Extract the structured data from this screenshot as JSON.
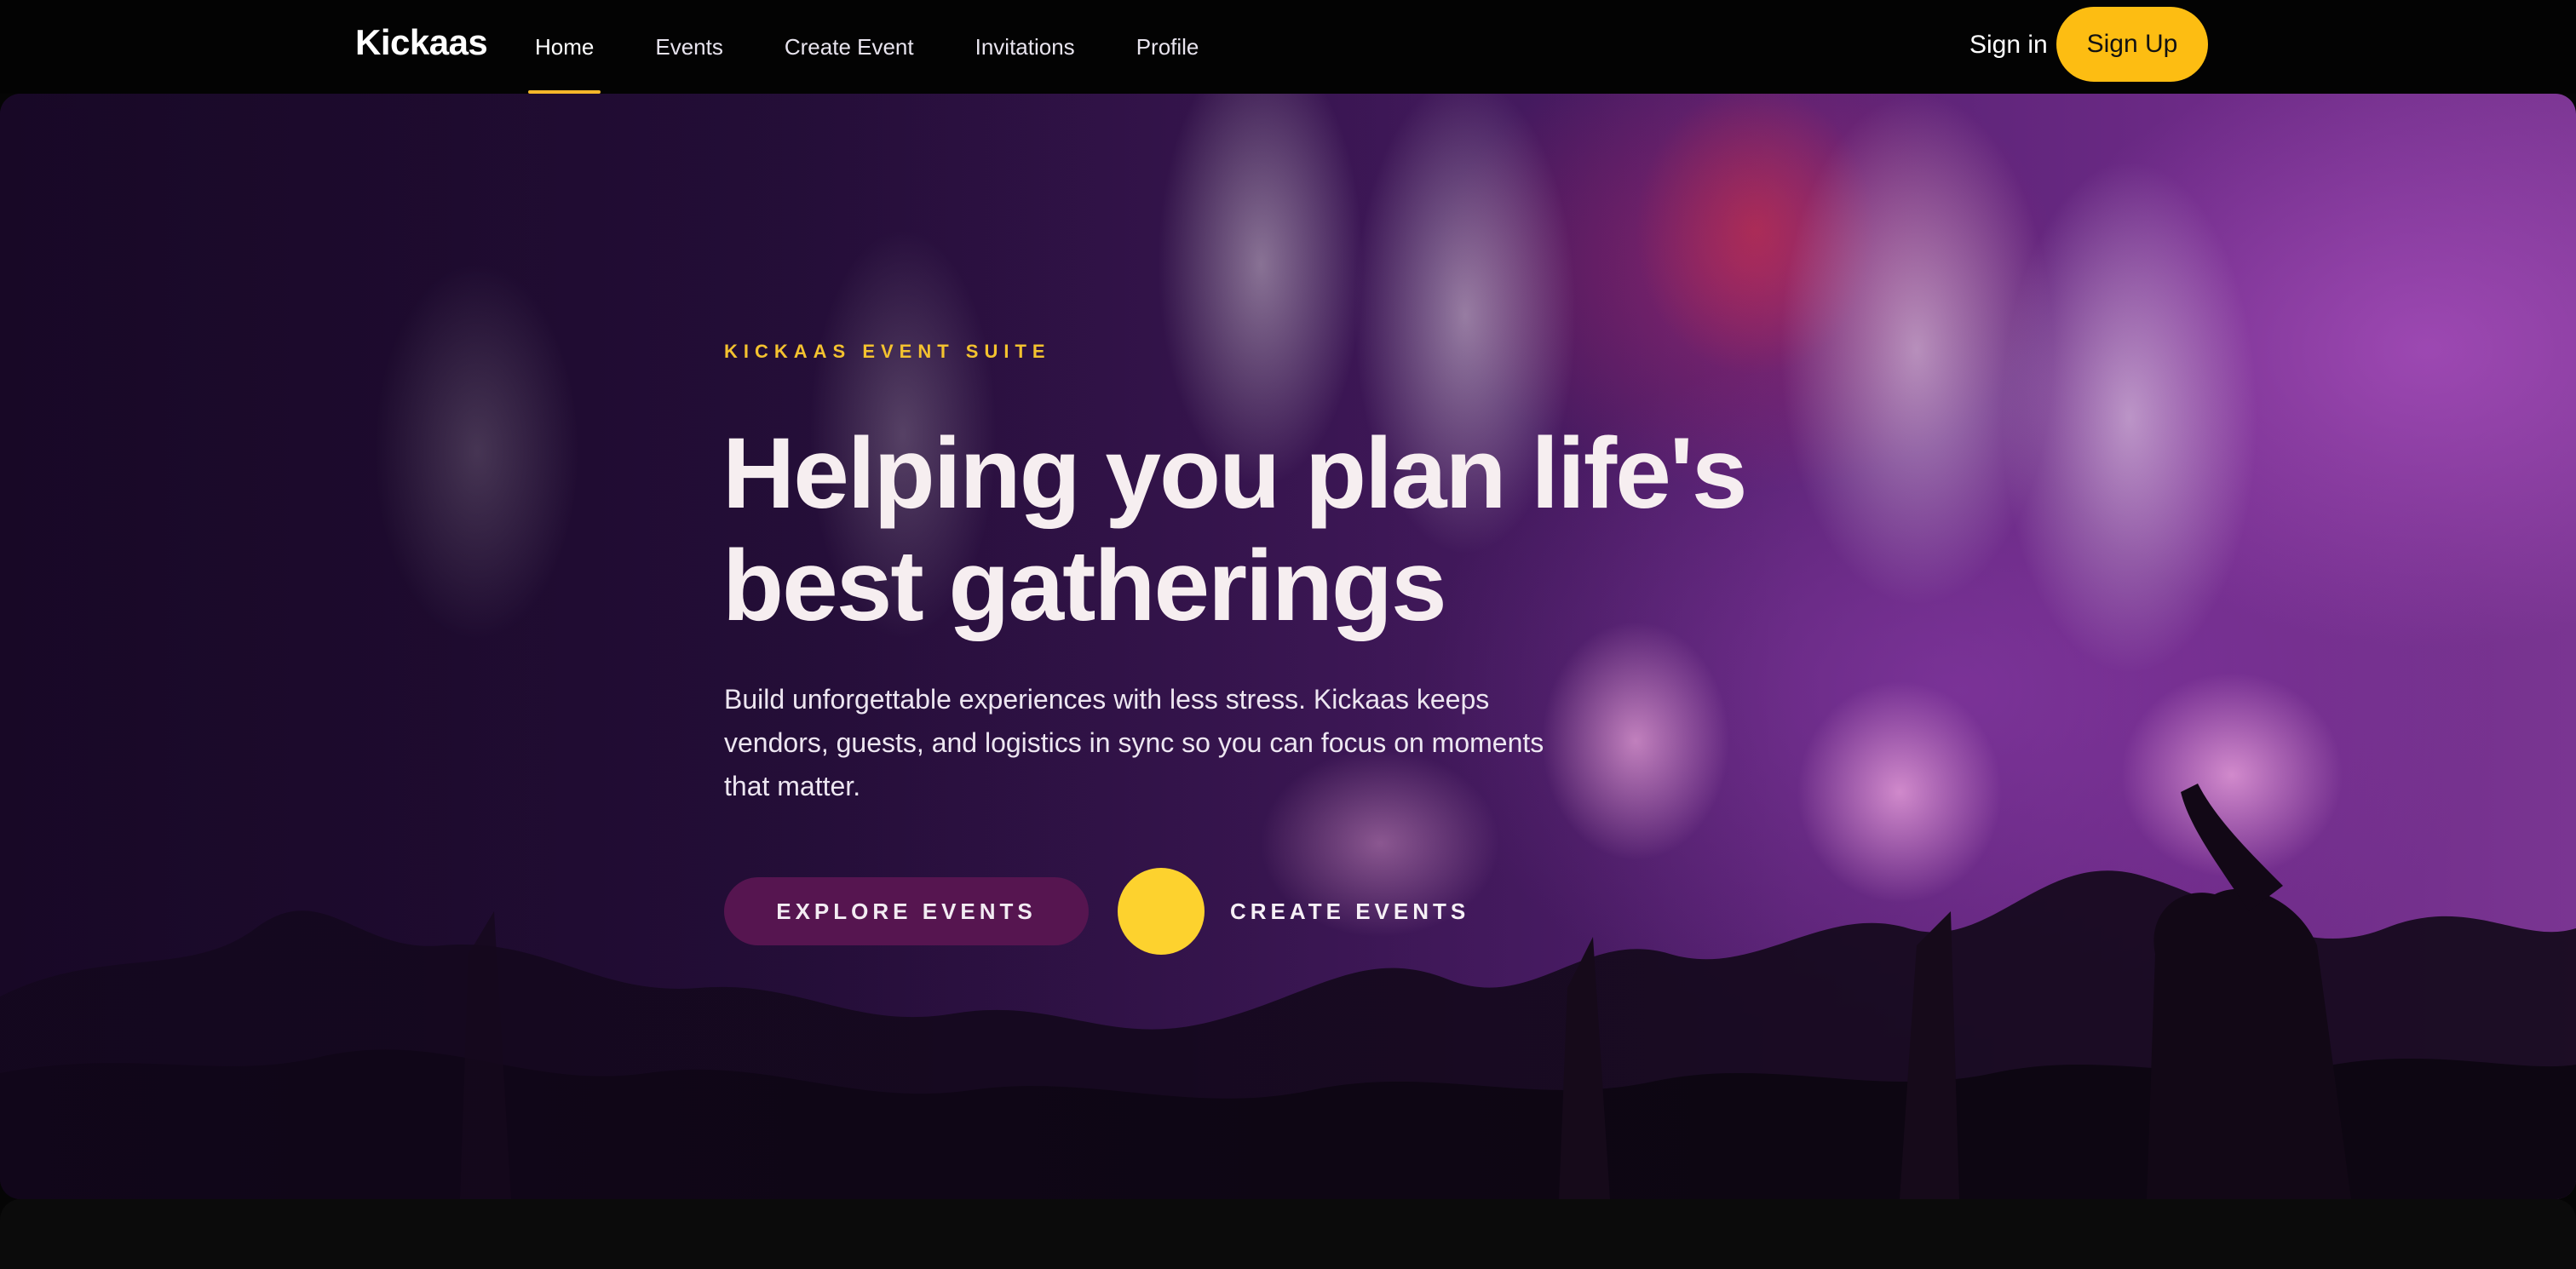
{
  "nav": {
    "brand": "Kickaas",
    "links": [
      {
        "label": "Home",
        "active": true
      },
      {
        "label": "Events",
        "active": false
      },
      {
        "label": "Create Event",
        "active": false
      },
      {
        "label": "Invitations",
        "active": false
      },
      {
        "label": "Profile",
        "active": false
      }
    ],
    "sign_in": "Sign in",
    "sign_up": "Sign Up"
  },
  "hero": {
    "eyebrow": "KICKAAS EVENT SUITE",
    "headline_line1": "Helping you plan life's",
    "headline_line2": "best gatherings",
    "subtext": "Build unforgettable experiences with less stress. Kickaas keeps vendors, guests, and logistics in sync so you can focus on moments that matter.",
    "primary_cta": "EXPLORE EVENTS",
    "secondary_cta": "CREATE EVENTS",
    "background": "concert-crowd-image"
  },
  "colors": {
    "accent": "#fdbd12",
    "cta_dot": "#fdd22e",
    "primary_button": "#561550",
    "eyebrow": "#f4c22f",
    "hero_purple": "#4a1c66"
  }
}
